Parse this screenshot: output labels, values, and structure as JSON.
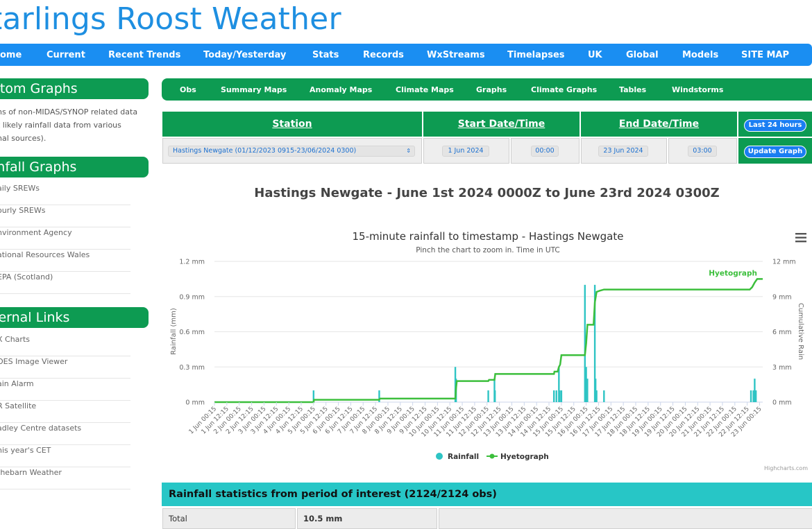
{
  "site": {
    "title": "tarlings Roost Weather"
  },
  "main_nav": [
    "ome",
    "Current",
    "Recent Trends",
    "Today/Yesterday",
    "Stats",
    "Records",
    "WxStreams",
    "Timelapses",
    "UK",
    "Global",
    "Models",
    "SITE MAP"
  ],
  "sidebar": {
    "custom_graphs": {
      "heading": "stom Graphs",
      "text": [
        "hs of non-MIDAS/SYNOP related data",
        "t likely rainfall data from various",
        "nal sources)."
      ]
    },
    "rainfall_graphs": {
      "heading": "infall Graphs",
      "links": [
        "aily SREWs",
        "ourly SREWs",
        "nvironment Agency",
        "ational Resources Wales",
        "EPA (Scotland)"
      ]
    },
    "external_links": {
      "heading": "ternal Links",
      "links": [
        "X Charts",
        "OES Image Viewer",
        "ain Alarm",
        "R Satellite",
        "adley Centre datasets",
        "his year's CET",
        "thebarn Weather"
      ]
    }
  },
  "sub_nav": [
    "Obs",
    "Summary Maps",
    "Anomaly Maps",
    "Climate Maps",
    "Graphs",
    "Climate Graphs",
    "Tables",
    "Windstorms"
  ],
  "form": {
    "station_label": "Station",
    "start_label": "Start Date/Time",
    "end_label": "End Date/Time",
    "last24_button": "Last 24 hours",
    "update_button": "Update Graph",
    "station_value": "Hastings Newgate (01/12/2023 0915-23/06/2024 0300)",
    "start_date": "1 Jun 2024",
    "start_time": "00:00",
    "end_date": "23 Jun 2024",
    "end_time": "03:00"
  },
  "graph_heading": "Hastings Newgate - June 1st 2024 0000Z to June 23rd 2024 0300Z",
  "menu_icon": "hamburger-menu-icon",
  "colors": {
    "rain": "#2ec4c4",
    "hyetograph": "#3cbf3c",
    "nav_blue": "#1a8ef2",
    "green": "#0d9b52"
  },
  "chart_data": {
    "type": "bar",
    "title": "15-minute rainfall to timestamp - Hastings Newgate",
    "subtitle": "Pinch the chart to zoom in. Time in UTC",
    "ylabel": "Rainfall (mm)",
    "y2label": "Cumulative Rain",
    "ylim": [
      0,
      1.2
    ],
    "y2lim": [
      0,
      12
    ],
    "y_ticks": [
      "0 mm",
      "0.3 mm",
      "0.6 mm",
      "0.9 mm",
      "1.2 mm"
    ],
    "y2_ticks": [
      "0 mm",
      "3 mm",
      "6 mm",
      "9 mm",
      "12 mm"
    ],
    "x_ticks": [
      "1 Jun 00:15",
      "1 Jun 12:15",
      "2 Jun 00:15",
      "2 Jun 12:15",
      "3 Jun 00:15",
      "3 Jun 12:15",
      "4 Jun 00:15",
      "4 Jun 12:15",
      "5 Jun 00:15",
      "5 Jun 12:15",
      "6 Jun 00:15",
      "6 Jun 12:15",
      "7 Jun 00:15",
      "7 Jun 12:15",
      "8 Jun 00:15",
      "8 Jun 12:15",
      "9 Jun 00:15",
      "9 Jun 12:15",
      "10 Jun 00:15",
      "10 Jun 12:15",
      "11 Jun 00:15",
      "11 Jun 12:15",
      "12 Jun 00:15",
      "12 Jun 12:15",
      "13 Jun 00:15",
      "13 Jun 12:15",
      "14 Jun 00:15",
      "14 Jun 12:15",
      "15 Jun 00:15",
      "15 Jun 12:15",
      "16 Jun 00:15",
      "16 Jun 12:15",
      "17 Jun 00:15",
      "17 Jun 12:15",
      "18 Jun 00:15",
      "18 Jun 12:15",
      "19 Jun 00:15",
      "19 Jun 12:15",
      "20 Jun 00:15",
      "20 Jun 12:15",
      "21 Jun 00:15",
      "21 Jun 12:15",
      "22 Jun 00:15",
      "22 Jun 12:15",
      "23 Jun 00:15"
    ],
    "x_range_days": [
      0,
      22.125
    ],
    "grid": true,
    "legend_placement": "bottom-center",
    "credit": "Highcharts.com",
    "series": [
      {
        "name": "Rainfall",
        "type": "bar",
        "points": [
          [
            4.0,
            0.1
          ],
          [
            6.65,
            0.1
          ],
          [
            9.72,
            0.3
          ],
          [
            9.75,
            0.2
          ],
          [
            11.05,
            0.1
          ],
          [
            11.3,
            0.2
          ],
          [
            11.32,
            0.1
          ],
          [
            13.7,
            0.1
          ],
          [
            13.8,
            0.1
          ],
          [
            13.9,
            0.3
          ],
          [
            13.93,
            0.1
          ],
          [
            14.0,
            0.1
          ],
          [
            14.95,
            1.0
          ],
          [
            15.0,
            0.3
          ],
          [
            15.05,
            0.2
          ],
          [
            15.35,
            1.0
          ],
          [
            15.38,
            0.2
          ],
          [
            15.42,
            0.1
          ],
          [
            15.72,
            0.1
          ],
          [
            21.65,
            0.1
          ],
          [
            21.75,
            0.1
          ],
          [
            21.8,
            0.2
          ],
          [
            21.85,
            0.1
          ]
        ]
      },
      {
        "name": "Hyetograph",
        "type": "line",
        "label": "Hyetograph",
        "points": [
          [
            0,
            0
          ],
          [
            4.0,
            0
          ],
          [
            4.02,
            0.2
          ],
          [
            6.65,
            0.2
          ],
          [
            6.68,
            0.3
          ],
          [
            9.72,
            0.3
          ],
          [
            9.74,
            1.0
          ],
          [
            9.78,
            1.8
          ],
          [
            11.05,
            1.8
          ],
          [
            11.08,
            1.9
          ],
          [
            11.3,
            1.9
          ],
          [
            11.33,
            2.4
          ],
          [
            13.7,
            2.4
          ],
          [
            13.72,
            2.6
          ],
          [
            13.85,
            2.6
          ],
          [
            13.9,
            3.0
          ],
          [
            13.95,
            3.2
          ],
          [
            14.0,
            4.0
          ],
          [
            14.95,
            4.0
          ],
          [
            15.0,
            5.0
          ],
          [
            15.05,
            6.6
          ],
          [
            15.3,
            6.6
          ],
          [
            15.35,
            8.5
          ],
          [
            15.42,
            9.4
          ],
          [
            15.55,
            9.5
          ],
          [
            15.72,
            9.6
          ],
          [
            17.0,
            9.6
          ],
          [
            21.6,
            9.6
          ],
          [
            21.7,
            9.8
          ],
          [
            21.8,
            10.2
          ],
          [
            21.9,
            10.5
          ],
          [
            22.125,
            10.5
          ]
        ]
      }
    ]
  },
  "stats": {
    "heading": "Rainfall statistics from period of interest (2124/2124 obs)",
    "total_label": "Total",
    "total_value": "10.5 mm"
  }
}
